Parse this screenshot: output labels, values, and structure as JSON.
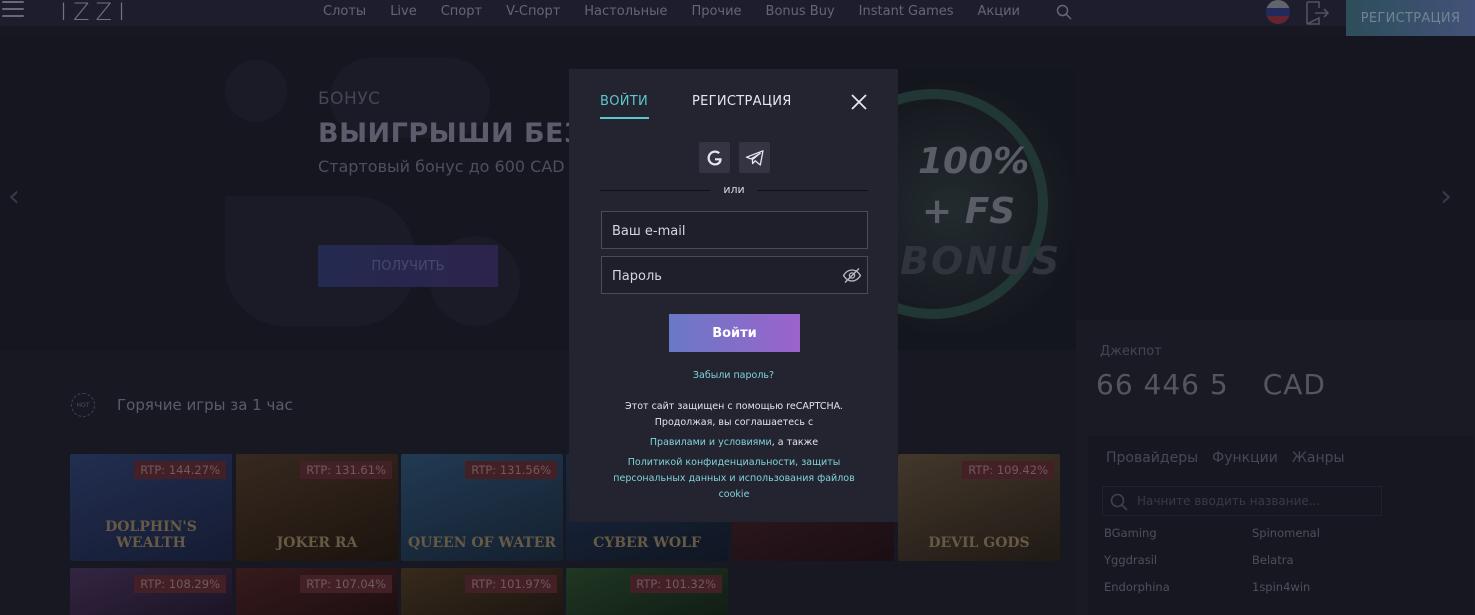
{
  "header": {
    "logo": "IZZI",
    "nav": [
      "Слоты",
      "Live",
      "Спорт",
      "V-Спорт",
      "Настольные",
      "Прочие",
      "Bonus Buy",
      "Instant Games",
      "Акции"
    ],
    "register_label": "РЕГИСТРАЦИЯ"
  },
  "hero": {
    "eyebrow": "БОНУС",
    "title": "ВЫИГРЫШИ БЕЗ",
    "subtitle": "Стартовый бонус до 600 CAD",
    "button_label": "ПОЛУЧИТЬ",
    "promo_line1": "100%",
    "promo_line2": "+ FS",
    "promo_line3": "BONUS"
  },
  "hot_games": {
    "badge": "HOT",
    "title": "Горячие игры за 1 час",
    "games": [
      {
        "name": "DOLPHIN'S WEALTH",
        "rtp": "RTP: 144.27%",
        "color": "#26355a"
      },
      {
        "name": "JOKER RA",
        "rtp": "RTP: 131.61%",
        "color": "#3a2a1f"
      },
      {
        "name": "QUEEN OF WATER",
        "rtp": "RTP: 131.56%",
        "color": "#24405a"
      },
      {
        "name": "CYBER WOLF",
        "rtp": "",
        "color": "#1f2f45"
      },
      {
        "name": "",
        "rtp": "",
        "color": "#3a1f22"
      },
      {
        "name": "DEVIL GODS",
        "rtp": "RTP: 109.42%",
        "color": "#4a3c2c"
      },
      {
        "name": "",
        "rtp": "RTP: 108.29%",
        "color": "#3a2a45"
      },
      {
        "name": "",
        "rtp": "RTP: 107.04%",
        "color": "#3a1f1f"
      },
      {
        "name": "",
        "rtp": "RTP: 101.97%",
        "color": "#3c2e1f"
      },
      {
        "name": "",
        "rtp": "RTP: 101.32%",
        "color": "#223a24"
      }
    ]
  },
  "sidebar": {
    "jackpot_label": "Джекпот",
    "jackpot_value": "66 446 5",
    "jackpot_currency": "CAD",
    "tabs": [
      "Провайдеры",
      "Функции",
      "Жанры"
    ],
    "search_placeholder": "Начните вводить название...",
    "providers": [
      "BGaming",
      "Spinomenal",
      "Yggdrasil",
      "Belatra",
      "Endorphina",
      "1spin4win"
    ]
  },
  "modal": {
    "tab_login": "ВОЙТИ",
    "tab_register": "РЕГИСТРАЦИЯ",
    "or_label": "или",
    "email_placeholder": "Ваш e-mail",
    "password_placeholder": "Пароль",
    "submit_label": "Войти",
    "forgot_label": "Забыли пароль?",
    "legal_line1": "Этот сайт защищен с помощью reCAPTCHA.",
    "legal_line2": "Продолжая, вы соглашаетесь с",
    "legal_terms_link": "Правилами и условиями",
    "legal_and": ", а также",
    "legal_privacy_link": "Политикой конфиденциальности, защиты персональных данных и использования файлов cookie"
  },
  "colors": {
    "accent": "#5ec6cd",
    "button_gradient_start": "#6a79c6",
    "button_gradient_end": "#9b63cc",
    "modal_bg": "#242431"
  }
}
